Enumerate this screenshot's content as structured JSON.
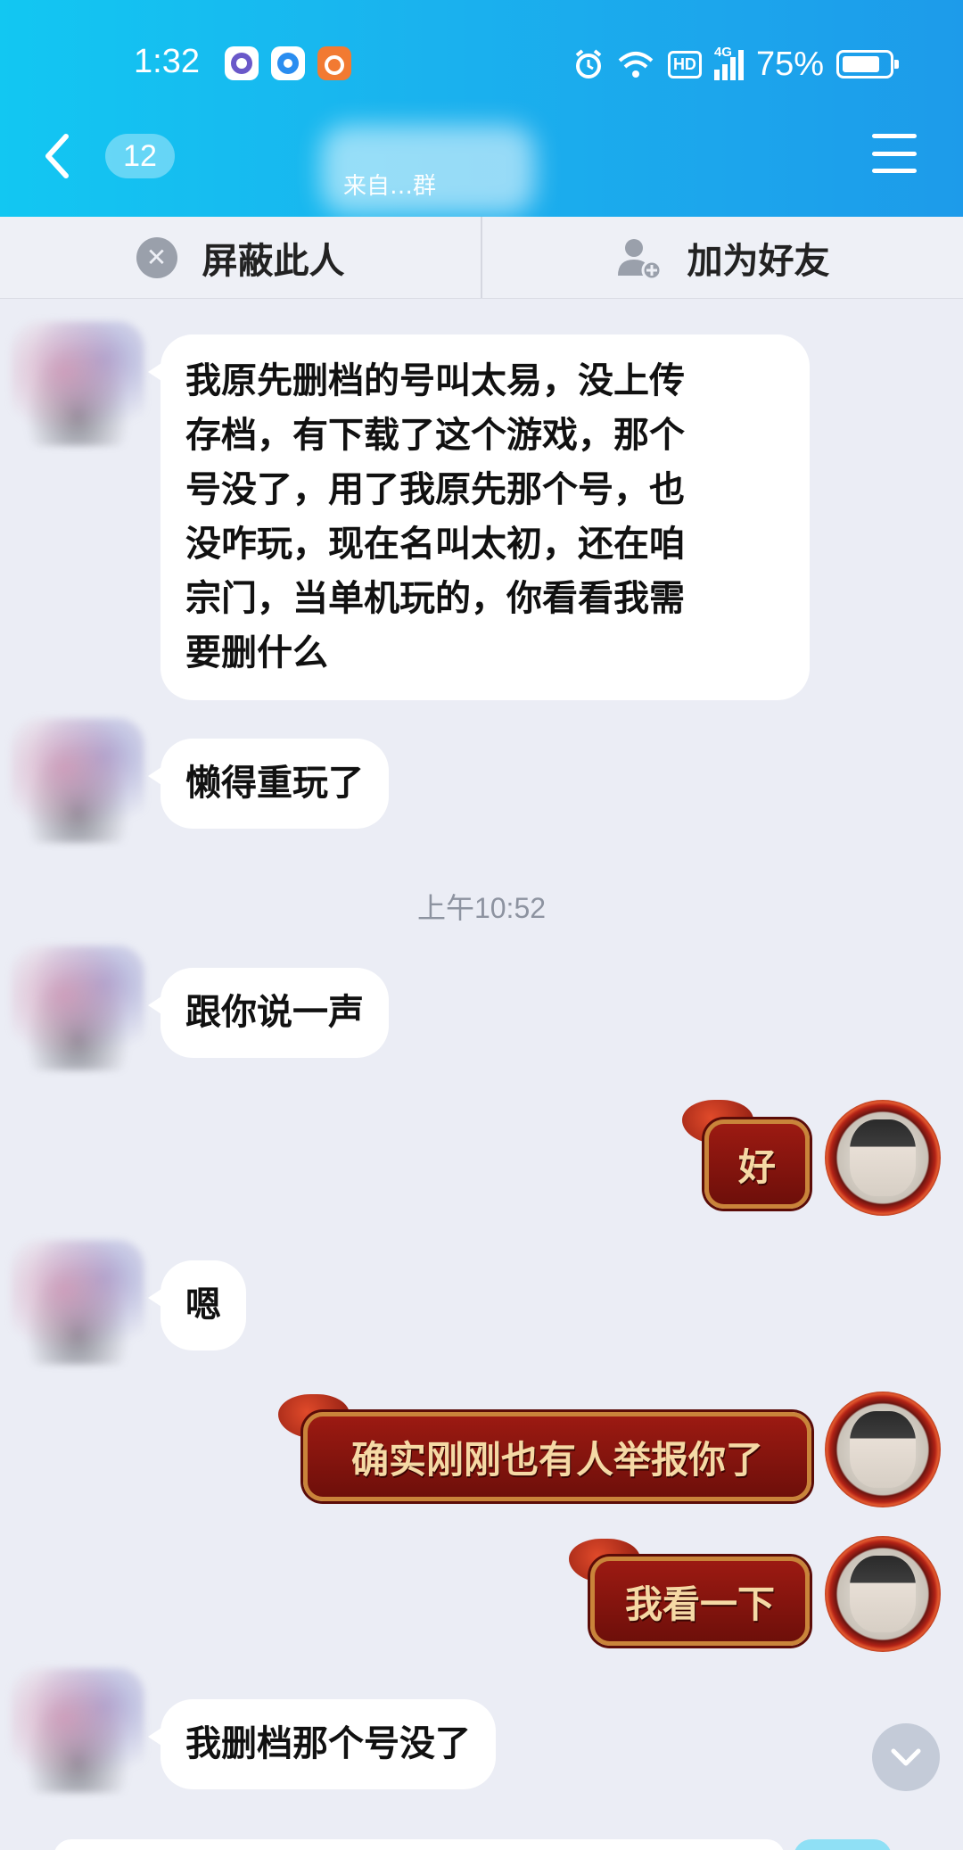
{
  "status_bar": {
    "time": "1:32",
    "network": "4G",
    "hd": "HD",
    "battery": "75%"
  },
  "header": {
    "unread_count": "12",
    "title": "来自…群"
  },
  "actions": {
    "block_label": "屏蔽此人",
    "add_friend_label": "加为好友"
  },
  "messages": [
    {
      "side": "left",
      "text": "我原先删档的号叫太易，没上传存档，有下载了这个游戏，那个号没了，用了我原先那个号，也没咋玩，现在名叫太初，还在咱宗门，当单机玩的，你看看我需要删什么"
    },
    {
      "side": "left",
      "text": "懒得重玩了"
    },
    {
      "side": "time",
      "text": "上午10:52"
    },
    {
      "side": "left",
      "text": "跟你说一声"
    },
    {
      "side": "right",
      "text": "好"
    },
    {
      "side": "left",
      "text": "嗯"
    },
    {
      "side": "right",
      "text": "确实刚刚也有人举报你了"
    },
    {
      "side": "right",
      "text": "我看一下"
    },
    {
      "side": "left",
      "text": "我删档那个号没了"
    }
  ],
  "message_lines": {
    "m1": [
      "我原先删档的号叫太易，没上传",
      "存档，有下载了这个游戏，那个",
      "号没了，用了我原先那个号，也",
      "没咋玩，现在名叫太初，还在咱",
      "宗门，当单机玩的，你看看我需",
      "要删什么"
    ]
  },
  "colors": {
    "header_start": "#12c7f2",
    "header_end": "#1d9bea",
    "background": "#ebedf5",
    "bubble_right": "#8b1710",
    "bubble_right_text": "#f5d9a5"
  }
}
